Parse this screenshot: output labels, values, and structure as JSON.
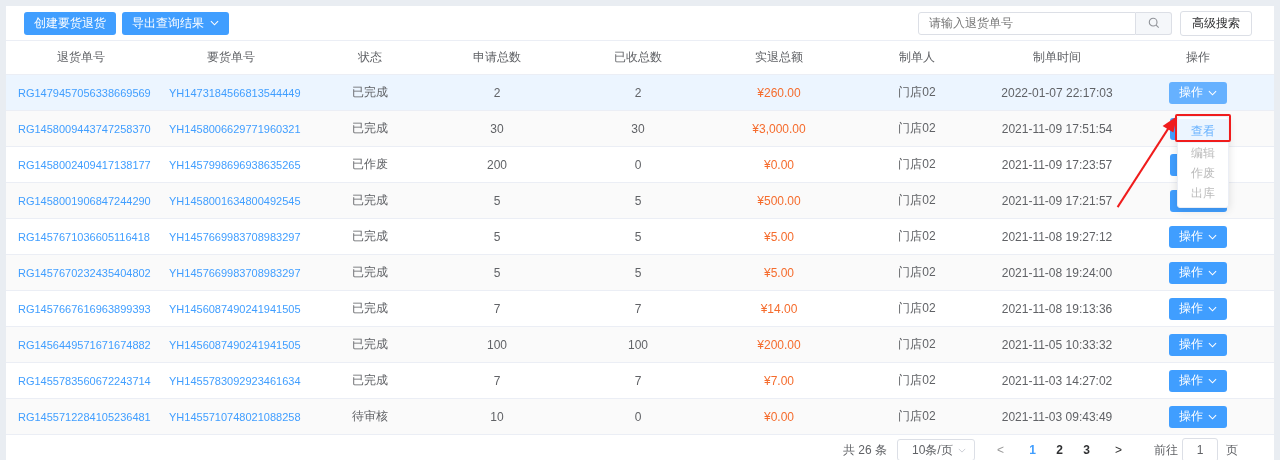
{
  "toolbar": {
    "buttons": [
      {
        "label": "创建要货退货",
        "kind": "plain"
      },
      {
        "label": "导出查询结果",
        "kind": "dropdown"
      }
    ],
    "search": {
      "placeholder": "请输入退货单号"
    },
    "advanced_button": "高级搜索"
  },
  "table": {
    "columns": [
      "退货单号",
      "要货单号",
      "状态",
      "申请总数",
      "已收总数",
      "实退总额",
      "制单人",
      "制单时间",
      "操作"
    ],
    "rows": [
      {
        "return_no": "RG1479457056338669569",
        "request_no": "YH1473184566813544449",
        "status": "已完成",
        "applied": "2",
        "received": "2",
        "amount": "¥260.00",
        "maker": "门店02",
        "time": "2022-01-07 22:17:03",
        "action": "操作",
        "selected": true
      },
      {
        "return_no": "RG1458009443747258370",
        "request_no": "YH1458006629771960321",
        "status": "已完成",
        "applied": "30",
        "received": "30",
        "amount": "¥3,000.00",
        "maker": "门店02",
        "time": "2021-11-09 17:51:54",
        "selected": false
      },
      {
        "return_no": "RG1458002409417138177",
        "request_no": "YH1457998696938635265",
        "status": "已作废",
        "applied": "200",
        "received": "0",
        "amount": "¥0.00",
        "maker": "门店02",
        "time": "2021-11-09 17:23:57",
        "selected": false
      },
      {
        "return_no": "RG1458001906847244290",
        "request_no": "YH1458001634800492545",
        "status": "已完成",
        "applied": "5",
        "received": "5",
        "amount": "¥500.00",
        "maker": "门店02",
        "time": "2021-11-09 17:21:57",
        "selected": false
      },
      {
        "return_no": "RG1457671036605116418",
        "request_no": "YH1457669983708983297",
        "status": "已完成",
        "applied": "5",
        "received": "5",
        "amount": "¥5.00",
        "maker": "门店02",
        "time": "2021-11-08 19:27:12",
        "action": "操作",
        "selected": false
      },
      {
        "return_no": "RG1457670232435404802",
        "request_no": "YH1457669983708983297",
        "status": "已完成",
        "applied": "5",
        "received": "5",
        "amount": "¥5.00",
        "maker": "门店02",
        "time": "2021-11-08 19:24:00",
        "action": "操作",
        "selected": false
      },
      {
        "return_no": "RG1457667616963899393",
        "request_no": "YH1456087490241941505",
        "status": "已完成",
        "applied": "7",
        "received": "7",
        "amount": "¥14.00",
        "maker": "门店02",
        "time": "2021-11-08 19:13:36",
        "action": "操作",
        "selected": false
      },
      {
        "return_no": "RG1456449571671674882",
        "request_no": "YH1456087490241941505",
        "status": "已完成",
        "applied": "100",
        "received": "100",
        "amount": "¥200.00",
        "maker": "门店02",
        "time": "2021-11-05 10:33:32",
        "action": "操作",
        "selected": false
      },
      {
        "return_no": "RG1455783560672243714",
        "request_no": "YH1455783092923461634",
        "status": "已完成",
        "applied": "7",
        "received": "7",
        "amount": "¥7.00",
        "maker": "门店02",
        "time": "2021-11-03 14:27:02",
        "action": "操作",
        "selected": false
      },
      {
        "return_no": "RG1455712284105236481",
        "request_no": "YH1455710748021088258",
        "status": "待审核",
        "applied": "10",
        "received": "0",
        "amount": "¥0.00",
        "maker": "门店02",
        "time": "2021-11-03 09:43:49",
        "action": "操作",
        "selected": false
      }
    ]
  },
  "action_menu": {
    "items": [
      {
        "label": "查看",
        "selected": true,
        "disabled": false
      },
      {
        "label": "编辑",
        "selected": false,
        "disabled": true
      },
      {
        "label": "作废",
        "selected": false,
        "disabled": true
      },
      {
        "label": "出库",
        "selected": false,
        "disabled": true
      }
    ]
  },
  "pagination": {
    "total": "共 26 条",
    "page_size": "10条/页",
    "prev": "<",
    "pages": [
      {
        "label": "1",
        "selected": true
      },
      {
        "label": "2",
        "selected": false
      },
      {
        "label": "3",
        "selected": false
      }
    ],
    "next": ">",
    "goto_label": "前往",
    "goto_value": "1",
    "goto_unit": "页"
  }
}
